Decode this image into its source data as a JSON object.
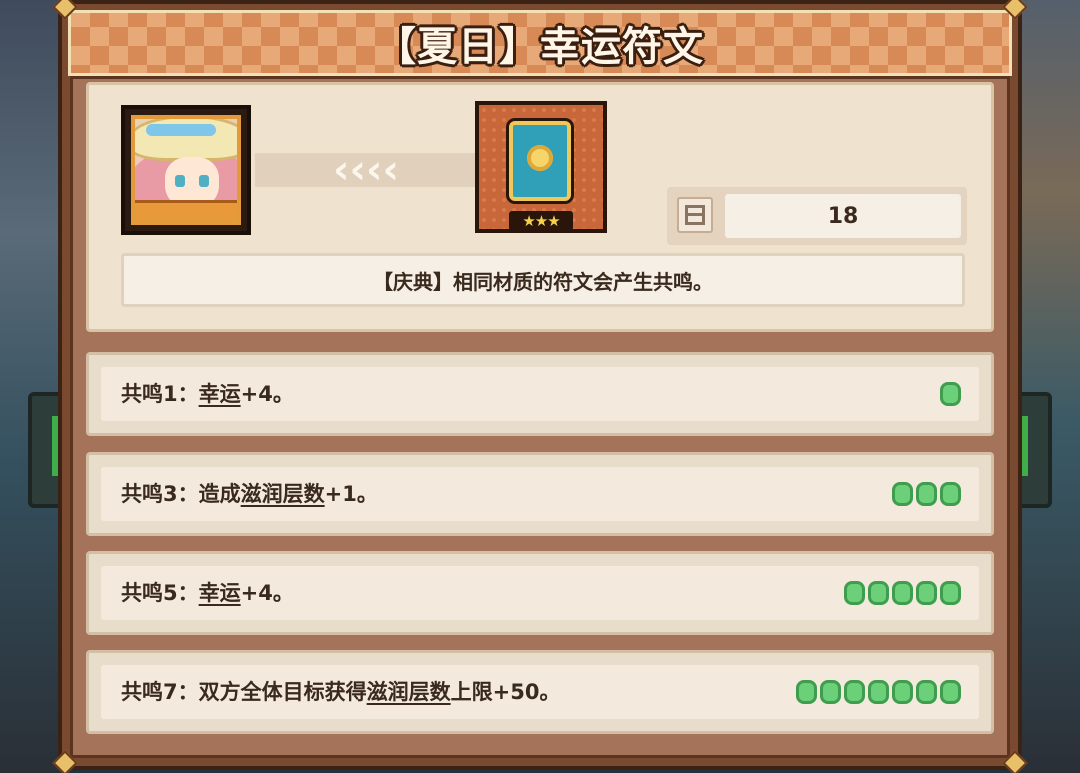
{
  "title": "【夏日】幸运符文",
  "portrait": {
    "icon": "character-portrait-icon"
  },
  "transfer_arrows": "‹‹‹‹",
  "rune": {
    "icon": "rune-card-icon",
    "stars": "★★★"
  },
  "stat": {
    "icon": "grid-icon",
    "value": "18"
  },
  "description": "【庆典】相同材质的符文会产生共鸣。",
  "resonances": [
    {
      "prefix": "共鸣1：",
      "pre": "",
      "keyword": "幸运",
      "suffix": "+4。",
      "active": 1
    },
    {
      "prefix": "共鸣3：",
      "pre": "造成",
      "keyword": "滋润层数",
      "suffix": "+1。",
      "active": 3
    },
    {
      "prefix": "共鸣5：",
      "pre": "",
      "keyword": "幸运",
      "suffix": "+4。",
      "active": 5
    },
    {
      "prefix": "共鸣7：",
      "pre": "双方全体目标获得",
      "keyword": "滋润层数",
      "suffix": "上限+50。",
      "active": 7
    }
  ],
  "colors": {
    "pip_fill": "#6cd07a",
    "pip_border": "#3e9e4e",
    "banner": "#d78a55",
    "panel": "#7a4a30"
  }
}
